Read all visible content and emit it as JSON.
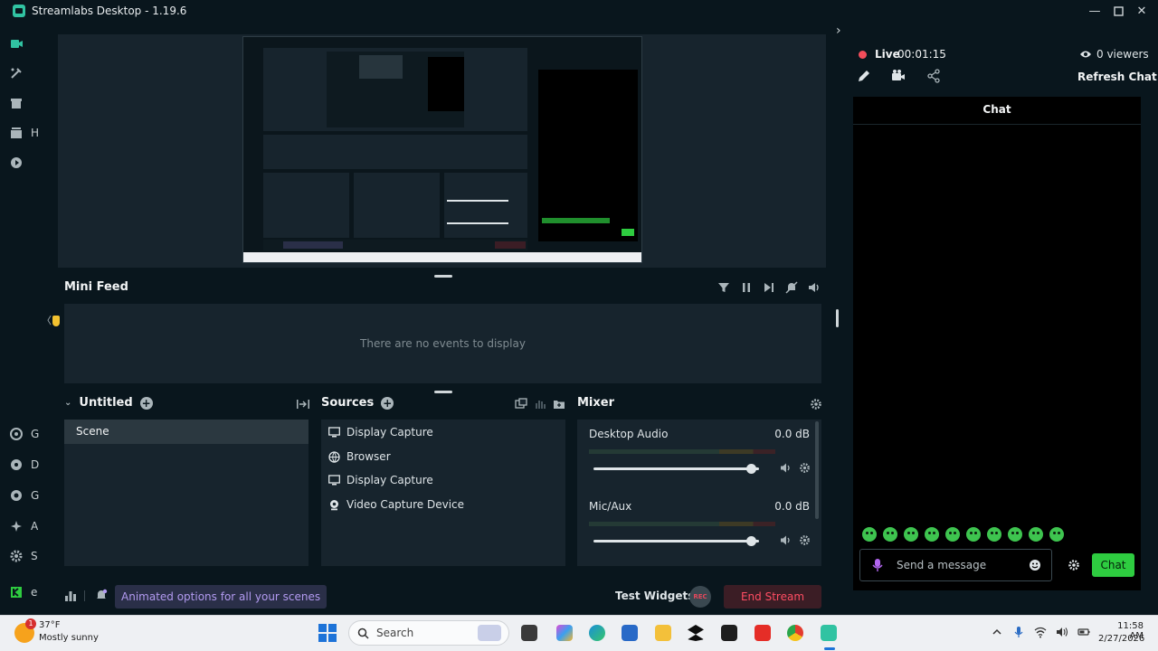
{
  "window": {
    "title": "Streamlabs Desktop - 1.19.6"
  },
  "sidebar": {
    "items": [
      {
        "icon": "studio-icon",
        "label": ""
      },
      {
        "icon": "themes-icon",
        "label": ""
      },
      {
        "icon": "store-icon",
        "label": ""
      },
      {
        "icon": "highlighter-icon",
        "label": "H"
      },
      {
        "icon": "play-icon",
        "label": ""
      }
    ],
    "bottom_items": [
      {
        "icon": "go-live-icon",
        "label": "G"
      },
      {
        "icon": "dashboard-icon",
        "label": "D"
      },
      {
        "icon": "get-help-icon",
        "label": "G"
      },
      {
        "icon": "apps-icon",
        "label": "A"
      },
      {
        "icon": "settings-icon",
        "label": "S"
      },
      {
        "icon": "kick-icon",
        "label": "e"
      }
    ]
  },
  "minifeed": {
    "title": "Mini Feed",
    "empty_text": "There are no events to display"
  },
  "scenes": {
    "collection": "Untitled",
    "items": [
      "Scene"
    ]
  },
  "sources": {
    "title": "Sources",
    "items": [
      {
        "name": "Display Capture",
        "icon": "monitor-icon"
      },
      {
        "name": "Browser",
        "icon": "globe-icon"
      },
      {
        "name": "Display Capture",
        "icon": "monitor-icon"
      },
      {
        "name": "Video Capture Device",
        "icon": "webcam-icon"
      }
    ]
  },
  "mixer": {
    "title": "Mixer",
    "channels": [
      {
        "name": "Desktop Audio",
        "db": "0.0 dB",
        "level": 0.95
      },
      {
        "name": "Mic/Aux",
        "db": "0.0 dB",
        "level": 0.95
      }
    ]
  },
  "bottombar": {
    "notification": "Animated options for all your scenes",
    "test_widgets": "Test Widgets",
    "rec_label": "REC",
    "end_stream": "End Stream"
  },
  "live": {
    "label": "Live",
    "time": "00:01:15",
    "viewers": "0 viewers",
    "refresh_chat": "Refresh Chat"
  },
  "chat": {
    "header": "Chat",
    "placeholder": "Send a message",
    "send_label": "Chat",
    "emote_count": 10
  },
  "taskbar": {
    "weather_badge": "1",
    "temp": "37°F",
    "condition": "Mostly sunny",
    "search_placeholder": "Search",
    "time": "11:58 AM",
    "date": "2/27/2026"
  },
  "colors": {
    "accent": "#31c3a2",
    "live_red": "#f24d5b",
    "chat_green": "#2ecc40",
    "notification_purple": "#b29af0"
  }
}
